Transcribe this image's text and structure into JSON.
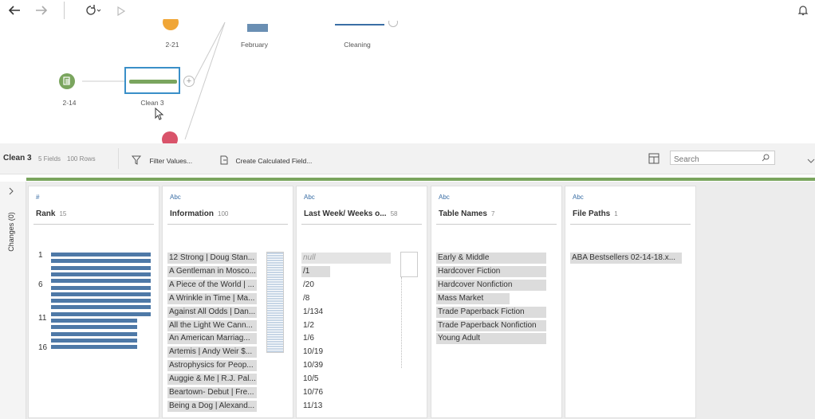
{
  "toolbar": {
    "back_icon": "back-arrow-icon",
    "forward_icon": "forward-arrow-icon",
    "refresh_icon": "refresh-icon",
    "run_icon": "play-icon",
    "notification_icon": "bell-icon"
  },
  "flow": {
    "nodes": [
      {
        "label": "2-21"
      },
      {
        "label": "February"
      },
      {
        "label": "Cleaning"
      },
      {
        "label": "2-14"
      },
      {
        "label": "Clean 3"
      }
    ]
  },
  "header": {
    "step_name": "Clean 3",
    "fields": "5 Fields",
    "rows": "100 Rows",
    "filter_label": "Filter Values...",
    "calc_label": "Create Calculated Field...",
    "search_placeholder": "Search"
  },
  "left_panel": {
    "changes_label": "Changes (0)"
  },
  "colors": {
    "accent_green": "#7aa55e",
    "bar_blue": "#4e79a7"
  },
  "cards": [
    {
      "type": "#",
      "name": "Rank",
      "count": "15",
      "ticks": [
        "1",
        "6",
        "11",
        "16"
      ],
      "bars": [
        1,
        1,
        1,
        1,
        1,
        1,
        1,
        1,
        1,
        1,
        0.86,
        0.86,
        0.86,
        0.86,
        0.86
      ]
    },
    {
      "type": "Abc",
      "name": "Information",
      "count": "100",
      "values": [
        "12 Strong | Doug Stan...",
        "A Gentleman in Mosco...",
        "A Piece of the World | ...",
        "A Wrinkle in Time | Ma...",
        "Against All Odds | Dan...",
        "All the Light We Cann...",
        "An American Marriag...",
        "Artemis | Andy Weir $...",
        "Astrophysics for Peop...",
        "Auggie & Me | R.J. Pal...",
        "Beartown- Debut | Fre...",
        "Being a Dog | Alexand..."
      ]
    },
    {
      "type": "Abc",
      "name": "Last Week/ Weeks o...",
      "count": "58",
      "values": [
        "null",
        "/1",
        "/20",
        "/8",
        "1/134",
        "1/2",
        "1/6",
        "10/19",
        "10/39",
        "10/5",
        "10/76",
        "11/13"
      ]
    },
    {
      "type": "Abc",
      "name": "Table Names",
      "count": "7",
      "values": [
        "Early & Middle",
        "Hardcover Fiction",
        "Hardcover Nonfiction",
        "Mass Market",
        "Trade Paperback Fiction",
        "Trade Paperback Nonfiction",
        "Young Adult"
      ]
    },
    {
      "type": "Abc",
      "name": "File Paths",
      "count": "1",
      "values": [
        "ABA Bestsellers 02-14-18.x..."
      ]
    }
  ]
}
